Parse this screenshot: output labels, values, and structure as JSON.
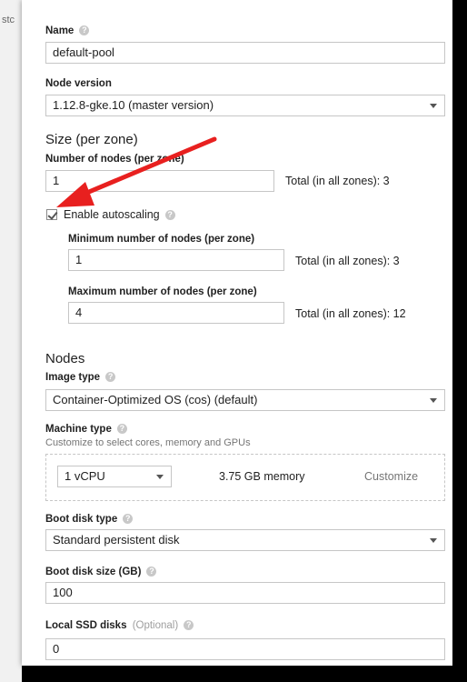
{
  "background": {
    "stub_text": "stc"
  },
  "name": {
    "label": "Name",
    "value": "default-pool"
  },
  "node_version": {
    "label": "Node version",
    "value": "1.12.8-gke.10 (master version)"
  },
  "size": {
    "heading": "Size (per zone)",
    "num_nodes_label": "Number of nodes (per zone)",
    "num_nodes_value": "1",
    "total": "Total (in all zones): 3",
    "autoscaling_label": "Enable autoscaling",
    "autoscaling_checked": true,
    "min_label": "Minimum number of nodes (per zone)",
    "min_value": "1",
    "min_total": "Total (in all zones): 3",
    "max_label": "Maximum number of nodes (per zone)",
    "max_value": "4",
    "max_total": "Total (in all zones): 12"
  },
  "nodes": {
    "heading": "Nodes",
    "image_type_label": "Image type",
    "image_type_value": "Container-Optimized OS (cos) (default)",
    "machine_type_label": "Machine type",
    "machine_type_hint": "Customize to select cores, memory and GPUs",
    "vcpu_value": "1 vCPU",
    "memory_text": "3.75 GB memory",
    "customize_label": "Customize",
    "boot_disk_type_label": "Boot disk type",
    "boot_disk_type_value": "Standard persistent disk",
    "boot_disk_size_label": "Boot disk size (GB)",
    "boot_disk_size_value": "100",
    "local_ssd_label": "Local SSD disks",
    "local_ssd_optional": "(Optional)",
    "local_ssd_value": "0"
  },
  "help_glyph": "?",
  "colors": {
    "annotation_arrow": "#e8201f",
    "muted_text": "#757575"
  }
}
